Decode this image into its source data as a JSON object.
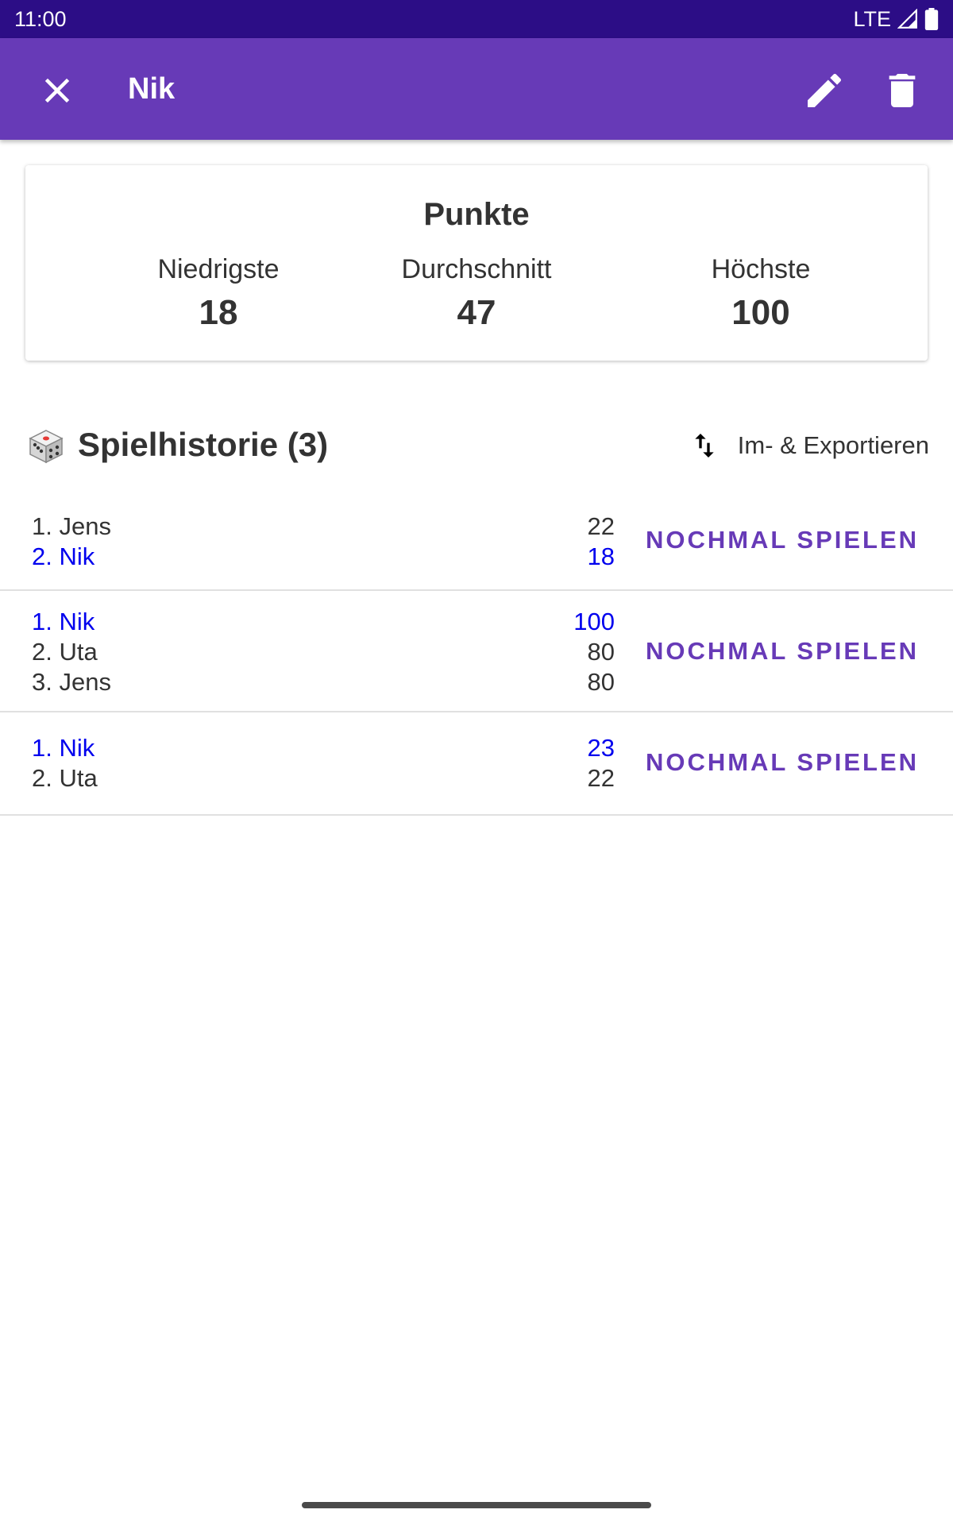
{
  "status_bar": {
    "time": "11:00",
    "network": "LTE"
  },
  "app_bar": {
    "title": "Nik",
    "close_icon": "close-icon",
    "edit_icon": "pencil-icon",
    "delete_icon": "trash-icon"
  },
  "stats": {
    "title": "Punkte",
    "items": [
      {
        "label": "Niedrigste",
        "value": "18"
      },
      {
        "label": "Durchschnitt",
        "value": "47"
      },
      {
        "label": "Höchste",
        "value": "100"
      }
    ]
  },
  "history": {
    "icon": "dice-icon",
    "title": "Spielhistorie (3)",
    "export_label": "Im- & Exportieren",
    "export_icon": "swap-vertical-icon",
    "games": [
      {
        "players": [
          {
            "name": "1. Jens",
            "score": "22",
            "highlight": false
          },
          {
            "name": "2. Nik",
            "score": "18",
            "highlight": true
          }
        ],
        "action": "NOCHMAL SPIELEN"
      },
      {
        "players": [
          {
            "name": "1. Nik",
            "score": "100",
            "highlight": true
          },
          {
            "name": "2. Uta",
            "score": "80",
            "highlight": false
          },
          {
            "name": "3. Jens",
            "score": "80",
            "highlight": false
          }
        ],
        "action": "NOCHMAL SPIELEN"
      },
      {
        "players": [
          {
            "name": "1. Nik",
            "score": "23",
            "highlight": true
          },
          {
            "name": "2. Uta",
            "score": "22",
            "highlight": false
          }
        ],
        "action": "NOCHMAL SPIELEN"
      }
    ]
  },
  "colors": {
    "primary": "#673ab7",
    "status_bar": "#2c0d86",
    "highlight": "#0000ee",
    "text": "#333333"
  }
}
